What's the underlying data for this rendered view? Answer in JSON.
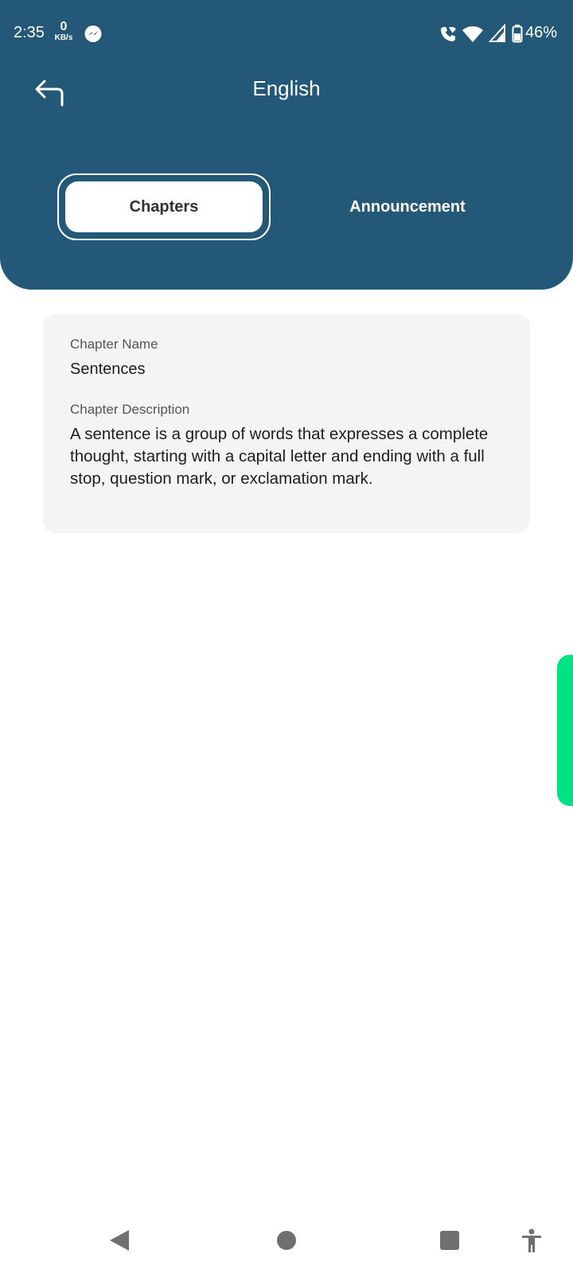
{
  "status_bar": {
    "time": "2:35",
    "net_speed_value": "0",
    "net_speed_unit": "KB/s",
    "battery": "46%",
    "icons": [
      "messenger-icon",
      "wifi-calling-icon",
      "wifi-icon",
      "signal-icon",
      "battery-icon"
    ]
  },
  "header": {
    "title": "English",
    "back_icon": "back-arrow-icon"
  },
  "tabs": [
    {
      "label": "Chapters",
      "selected": true
    },
    {
      "label": "Announcement",
      "selected": false
    }
  ],
  "chapter": {
    "name_label": "Chapter Name",
    "name": "Sentences",
    "description_label": "Chapter Description",
    "description": "A sentence is a group of words that expresses a complete thought, starting with a capital letter and ending with a full stop, question mark, or exclamation mark."
  },
  "nav_bar": {
    "icons": [
      "nav-back-icon",
      "nav-home-icon",
      "nav-recents-icon",
      "accessibility-icon"
    ]
  },
  "colors": {
    "header_bg": "#235878",
    "card_bg": "#f4f4f4",
    "side_tab": "#00e384"
  }
}
